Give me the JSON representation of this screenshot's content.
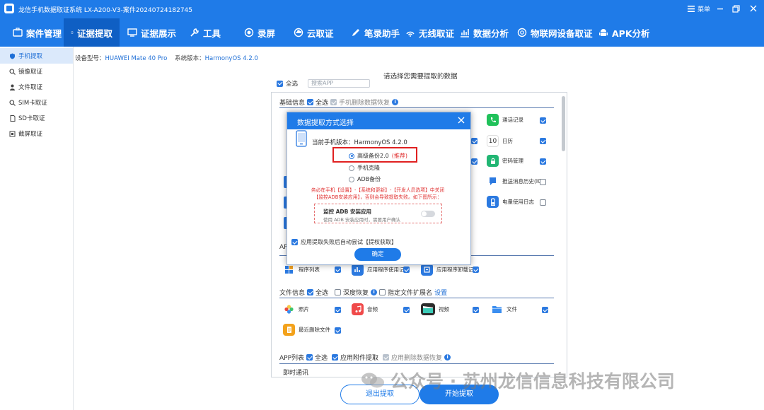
{
  "window": {
    "title": "龙信手机数据取证系统 LX-A200-V3-案件20240724182745",
    "menu_label": "菜单"
  },
  "nav": [
    {
      "label": "案件管理",
      "icon": "case-icon"
    },
    {
      "label": "证据提取",
      "icon": "phone-icon"
    },
    {
      "label": "证据展示",
      "icon": "display-icon"
    },
    {
      "label": "工具",
      "icon": "tools-icon"
    },
    {
      "label": "录屏",
      "icon": "record-icon"
    },
    {
      "label": "云取证",
      "icon": "cloud-icon"
    },
    {
      "label": "笔录助手",
      "icon": "notes-icon"
    },
    {
      "label": "无线取证",
      "icon": "wireless-icon"
    },
    {
      "label": "数据分析",
      "icon": "analysis-icon"
    },
    {
      "label": "物联网设备取证",
      "icon": "iot-icon"
    },
    {
      "label": "APK分析",
      "icon": "android-icon"
    }
  ],
  "sidebar": [
    {
      "label": "手机提取"
    },
    {
      "label": "镜像取证"
    },
    {
      "label": "文件取证"
    },
    {
      "label": "SIM卡取证"
    },
    {
      "label": "SD卡取证"
    },
    {
      "label": "截屏取证"
    }
  ],
  "device": {
    "model_label": "设备型号：",
    "model": "HUAWEI Mate 40 Pro",
    "os_label": "系统版本：",
    "os": "HarmonyOS 4.2.0"
  },
  "main": {
    "heading": "请选择您需要提取的数据",
    "select_all": "全选",
    "search_placeholder": "搜索APP",
    "basic": {
      "title": "基础信息",
      "select_all": "全选",
      "deleted_recovery": "手机删除数据恢复"
    },
    "basic_items": [
      {
        "label": "通话记录"
      },
      {
        "label": "日历",
        "icon_text": "10"
      },
      {
        "label": "密码管理"
      },
      {
        "label": "推送消息历史(IO"
      },
      {
        "label": "电量使用日志"
      }
    ],
    "app_partial_label": "APP",
    "app_items": [
      {
        "label": "程序列表"
      },
      {
        "label": "应用程序使用记录"
      },
      {
        "label": "应用程序卸载记录"
      }
    ],
    "files": {
      "title": "文件信息",
      "select_all": "全选",
      "deep_recovery": "深度恢复",
      "ext_label": "指定文件扩展名",
      "settings_link": "设置"
    },
    "file_items": [
      {
        "label": "照片"
      },
      {
        "label": "音频"
      },
      {
        "label": "视频"
      },
      {
        "label": "文件"
      },
      {
        "label": "最近删除文件"
      }
    ],
    "app_list": {
      "title": "APP列表",
      "select_all": "全选",
      "attachment": "应用附件提取",
      "deleted_recovery": "应用删除数据恢复"
    },
    "im_label": "即时通讯"
  },
  "modal": {
    "title": "数据提取方式选择",
    "os_label": "当前手机版本：",
    "os_value": "HarmonyOS 4.2.0",
    "options": [
      {
        "label": "高级备份2.0",
        "badge": "(推荐)",
        "selected": true
      },
      {
        "label": "手机克隆",
        "selected": false
      },
      {
        "label": "ADB备份",
        "selected": false
      }
    ],
    "warning": "务必在手机【设置】-【系统和更新】-【开发人员选项】中关闭【监控ADB安装应用】，否则会导致提取失败。如下图所示：",
    "adb_title": "监控 ADB 安装应用",
    "adb_desc": "使用 ADB 安装应用时，需要用户确认",
    "auto_retry": "应用提取失败后自动尝试【提权获取】",
    "confirm": "确定"
  },
  "footer": {
    "exit": "退出提取",
    "start": "开始提取"
  },
  "watermark": "公众号 · 苏州龙信信息科技有限公司",
  "colors": {
    "primary": "#1f7be8",
    "active_nav": "#0f5fc4",
    "warning": "#e03131",
    "highlight_box": "#e02020"
  }
}
